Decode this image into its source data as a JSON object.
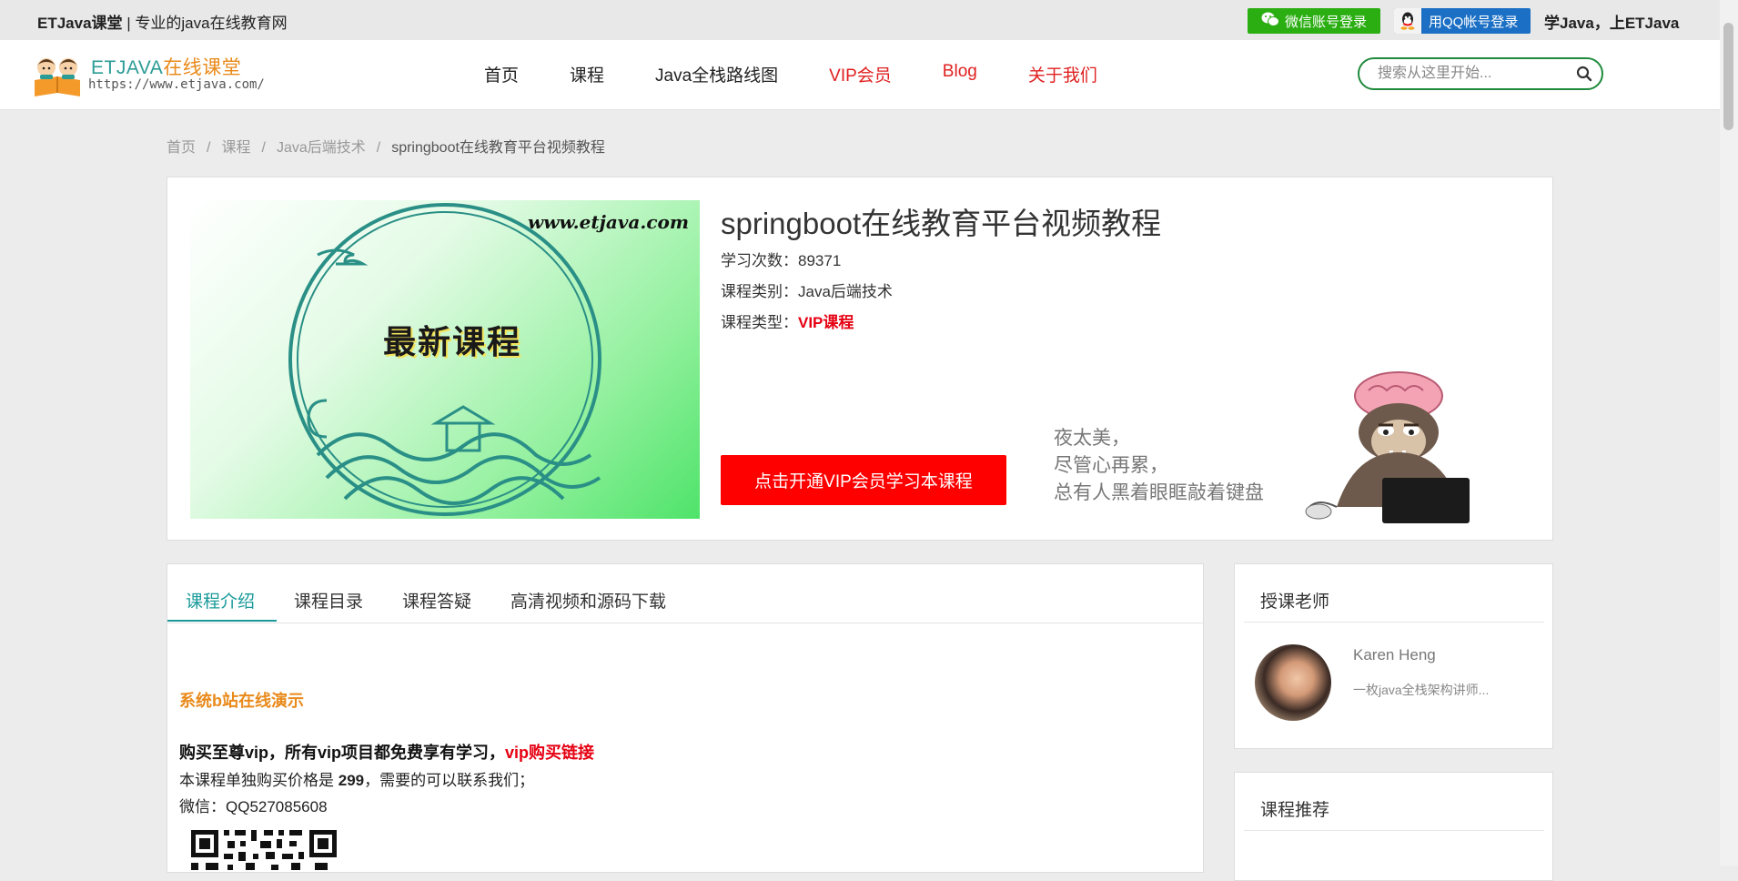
{
  "topbar": {
    "brand_bold": "ETJava课堂",
    "brand_rest": " | 专业的java在线教育网",
    "wechat_login": "微信账号登录",
    "qq_login": "用QQ帐号登录",
    "slogan": "学Java，上ETJava"
  },
  "logo": {
    "name_en": "ETJAVA",
    "name_cn": "在线课堂",
    "url": "https://www.etjava.com/"
  },
  "nav": {
    "items": [
      {
        "label": "首页"
      },
      {
        "label": "课程"
      },
      {
        "label": "Java全栈路线图"
      },
      {
        "label": "VIP会员"
      },
      {
        "label": "Blog"
      },
      {
        "label": "关于我们"
      }
    ],
    "search_placeholder": "搜索从这里开始..."
  },
  "breadcrumb": {
    "items": [
      "首页",
      "课程",
      "Java后端技术"
    ],
    "sep": "/",
    "current": "springboot在线教育平台视频教程"
  },
  "course": {
    "title": "springboot在线教育平台视频教程",
    "study_label": "学习次数：",
    "study_count": "89371",
    "category_label": "课程类别：",
    "category": "Java后端技术",
    "type_label": "课程类型：",
    "type": "VIP课程",
    "cta": "点击开通VIP会员学习本课程",
    "cover_url": "www.etjava.com",
    "cover_badge": "最新课程",
    "quote": [
      "夜太美，",
      "尽管心再累，",
      "总有人黑着眼眶敲着键盘"
    ]
  },
  "tabs": [
    {
      "label": "课程介绍"
    },
    {
      "label": "课程目录"
    },
    {
      "label": "课程答疑"
    },
    {
      "label": "高清视频和源码下载"
    }
  ],
  "intro": {
    "demo_title": "系统b站在线演示",
    "vip_text": "购买至尊vip，所有vip项目都免费享有学习，",
    "vip_link": "vip购买链接",
    "price_pre": "本课程单独购买价格是 ",
    "price": "299",
    "price_post": "，需要的可以联系我们；",
    "wechat": "微信：QQ527085608"
  },
  "teacher": {
    "heading": "授课老师",
    "name": "Karen Heng",
    "desc": "一枚java全栈架构讲师..."
  },
  "recommend": {
    "heading": "课程推荐"
  },
  "colors": {
    "accent": "#1a9a9a",
    "red": "#e60012",
    "orange": "#e98a1b",
    "wechat_green": "#2aae12",
    "qq_blue": "#1b6fc4"
  }
}
